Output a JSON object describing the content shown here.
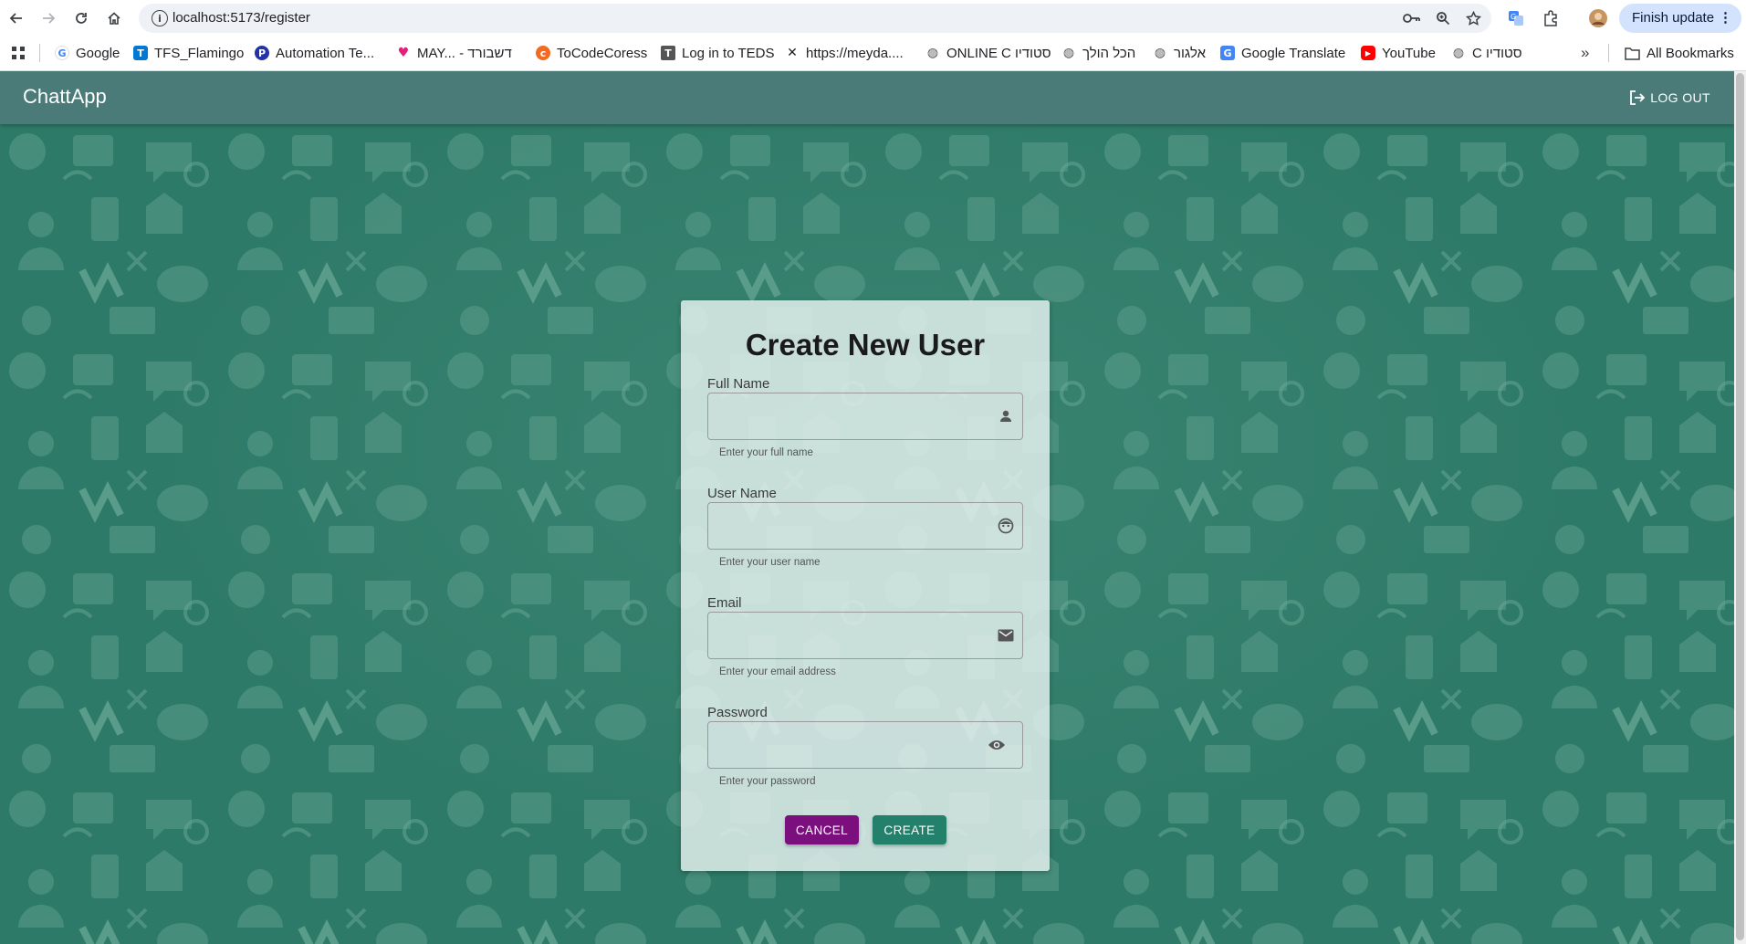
{
  "browser": {
    "url": "localhost:5173/register",
    "finish_update_label": "Finish update",
    "bookmarks": [
      {
        "label": "Google",
        "icon": "google-icon"
      },
      {
        "label": "TFS_Flamingo",
        "icon": "tfs-icon"
      },
      {
        "label": "Automation Te...",
        "icon": "automation-icon"
      },
      {
        "label": "MAY... - דשבורד",
        "icon": "heart-icon"
      },
      {
        "label": "ToCodeCoress",
        "icon": "tocode-icon"
      },
      {
        "label": "Log in to TEDS",
        "icon": "teds-icon"
      },
      {
        "label": "https://meyda....",
        "icon": "meyda-icon"
      },
      {
        "label": "ONLINE C סטודיו",
        "icon": "globe-icon"
      },
      {
        "label": "הכל הולך",
        "icon": "globe-icon"
      },
      {
        "label": "אלגור",
        "icon": "globe-icon"
      },
      {
        "label": "Google Translate",
        "icon": "translate-icon"
      },
      {
        "label": "YouTube",
        "icon": "youtube-icon"
      },
      {
        "label": "C סטודיו",
        "icon": "globe-icon"
      }
    ],
    "all_bookmarks_label": "All Bookmarks"
  },
  "appbar": {
    "title": "ChattApp",
    "logout_label": "LOG OUT"
  },
  "form": {
    "title": "Create New User",
    "fields": [
      {
        "label": "Full Name",
        "value": "",
        "helper": "Enter your full name",
        "icon": "person-icon"
      },
      {
        "label": "User Name",
        "value": "",
        "helper": "Enter your user name",
        "icon": "face-icon"
      },
      {
        "label": "Email",
        "value": "",
        "helper": "Enter your email address",
        "icon": "mail-icon"
      },
      {
        "label": "Password",
        "value": "",
        "helper": "Enter your password",
        "icon": "eye-icon"
      }
    ],
    "cancel_label": "CANCEL",
    "create_label": "CREATE"
  },
  "colors": {
    "appbar": "#4a7b78",
    "background": "#2e7a68",
    "cancel_button": "#7b0f7e",
    "create_button": "#22806b"
  }
}
